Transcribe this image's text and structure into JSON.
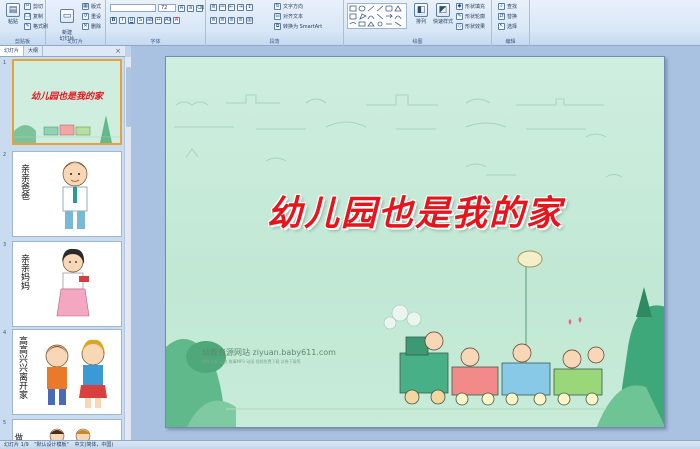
{
  "ribbon": {
    "clipboard": {
      "paste": "粘贴",
      "cut": "剪切",
      "copy": "复制",
      "format_painter": "格式刷",
      "label": "剪贴板"
    },
    "slides": {
      "new_slide": "新建\n幻灯片",
      "layout": "版式",
      "reset": "重设",
      "delete": "删除",
      "label": "幻灯片"
    },
    "font": {
      "font_name": "",
      "font_size": "72",
      "label": "字体"
    },
    "paragraph": {
      "text_direction": "文字方向",
      "align_text": "对齐文本",
      "smartart": "转换为 SmartArt",
      "label": "段落"
    },
    "drawing": {
      "arrange": "排列",
      "quick_styles": "快速样式",
      "shape_fill": "形状填充",
      "shape_outline": "形状轮廓",
      "shape_effects": "形状效果",
      "label": "绘图"
    },
    "editing": {
      "find": "查找",
      "replace": "替换",
      "select": "选择",
      "label": "编辑"
    }
  },
  "panel": {
    "tabs": [
      "幻灯片",
      "大纲"
    ],
    "close": "×",
    "thumbnails": [
      {
        "number": "1",
        "text": "幼儿园也是我的家"
      },
      {
        "number": "2",
        "text": "亲亲爸爸"
      },
      {
        "number": "3",
        "text": "亲亲妈妈"
      },
      {
        "number": "4",
        "text": "高高兴兴离开家"
      },
      {
        "number": "5",
        "text": "做"
      }
    ]
  },
  "slide": {
    "title": "幼儿园也是我的家",
    "watermark": "幼教资源网站  ziyuan.baby611.com",
    "watermark_sub": "课件下载  儿歌 故事MP3 动画 视频免费下载 试卷下载等"
  },
  "statusbar": {
    "slide_count": "幻灯片 1/9",
    "theme": "\"默认设计模板\"",
    "language": "中文(简体，中国)"
  },
  "colors": {
    "title_red": "#e8141c",
    "slide_bg": "#c7ecd9",
    "selection": "#e8a23a"
  }
}
